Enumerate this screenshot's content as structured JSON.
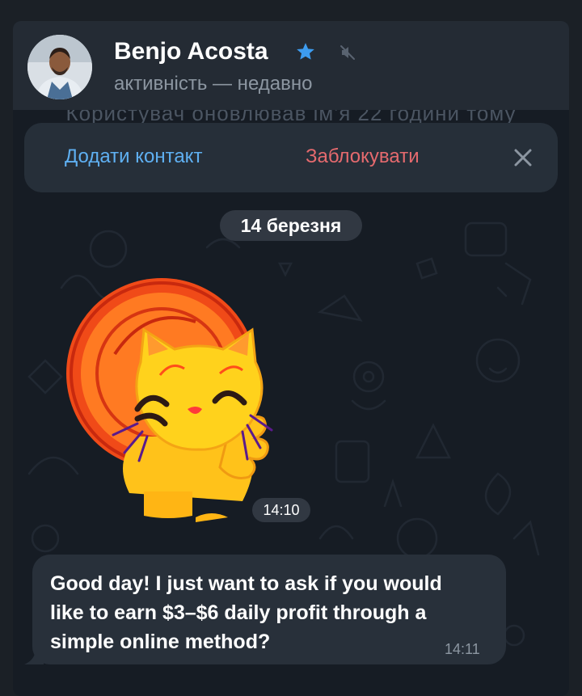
{
  "header": {
    "name": "Benjo Acosta",
    "status": "активність — недавно",
    "star_icon": "star-icon",
    "mute_icon": "muted-speaker-icon",
    "ghost_text": "Користувач оновлював ім'я 22 години тому"
  },
  "action_bar": {
    "add_contact_label": "Додати контакт",
    "block_label": "Заблокувати",
    "close_icon": "close-icon"
  },
  "chat": {
    "date_chip": "14 березня",
    "sticker_time": "14:10",
    "message_text": "Good day! I just want to ask if you would like to earn $3–$6 daily profit through a simple online method?",
    "message_time": "14:11"
  },
  "colors": {
    "background": "#161c24",
    "header": "#242b34",
    "accent_blue": "#5fb0f2",
    "danger_red": "#e56a6e",
    "bubble": "#28303a"
  }
}
